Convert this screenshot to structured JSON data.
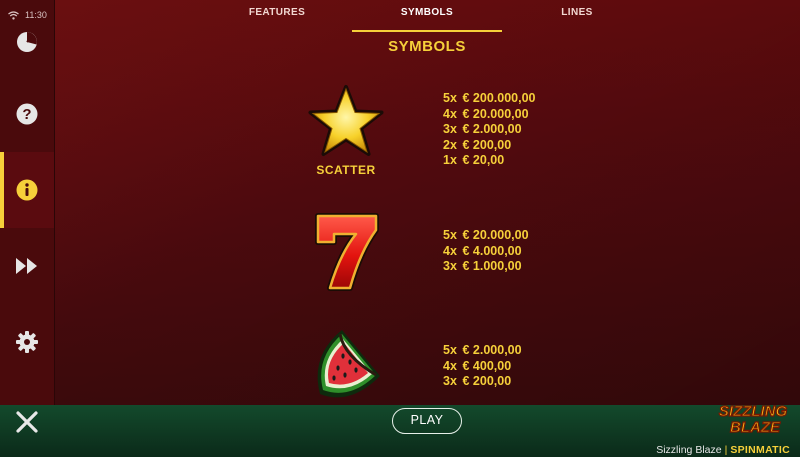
{
  "status_bar": {
    "time": "11:30"
  },
  "tabs": [
    {
      "label": "FEATURES",
      "active": false
    },
    {
      "label": "SYMBOLS",
      "active": true
    },
    {
      "label": "LINES",
      "active": false
    }
  ],
  "sidebar": {
    "items": [
      {
        "name": "history",
        "icon": "history-chart-icon"
      },
      {
        "name": "help",
        "icon": "question-icon"
      },
      {
        "name": "info",
        "icon": "info-icon",
        "active": true
      },
      {
        "name": "turbo",
        "icon": "fast-forward-icon"
      },
      {
        "name": "settings",
        "icon": "gear-icon"
      }
    ]
  },
  "section_title": "SYMBOLS",
  "symbols": [
    {
      "name": "star",
      "label": "SCATTER",
      "payouts": [
        {
          "mult": "5x",
          "amount": "€ 200.000,00"
        },
        {
          "mult": "4x",
          "amount": "€ 20.000,00"
        },
        {
          "mult": "3x",
          "amount": "€ 2.000,00"
        },
        {
          "mult": "2x",
          "amount": "€ 200,00"
        },
        {
          "mult": "1x",
          "amount": "€ 20,00"
        }
      ]
    },
    {
      "name": "seven",
      "label": "",
      "payouts": [
        {
          "mult": "5x",
          "amount": "€ 20.000,00"
        },
        {
          "mult": "4x",
          "amount": "€ 4.000,00"
        },
        {
          "mult": "3x",
          "amount": "€ 1.000,00"
        }
      ]
    },
    {
      "name": "watermelon",
      "label": "",
      "payouts": [
        {
          "mult": "5x",
          "amount": "€ 2.000,00"
        },
        {
          "mult": "4x",
          "amount": "€ 400,00"
        },
        {
          "mult": "3x",
          "amount": "€ 200,00"
        }
      ]
    }
  ],
  "bottom": {
    "play_label": "PLAY",
    "game_name": "Sizzling Blaze",
    "separator": "|",
    "provider": "SPINMATIC",
    "logo_line1": "SIZZLING",
    "logo_line2": "BLAZE"
  },
  "colors": {
    "accent": "#f6d03a",
    "background": "#5a0b0e",
    "sidebar": "#4a0a0c",
    "bottom_bar": "#0f3a22"
  }
}
